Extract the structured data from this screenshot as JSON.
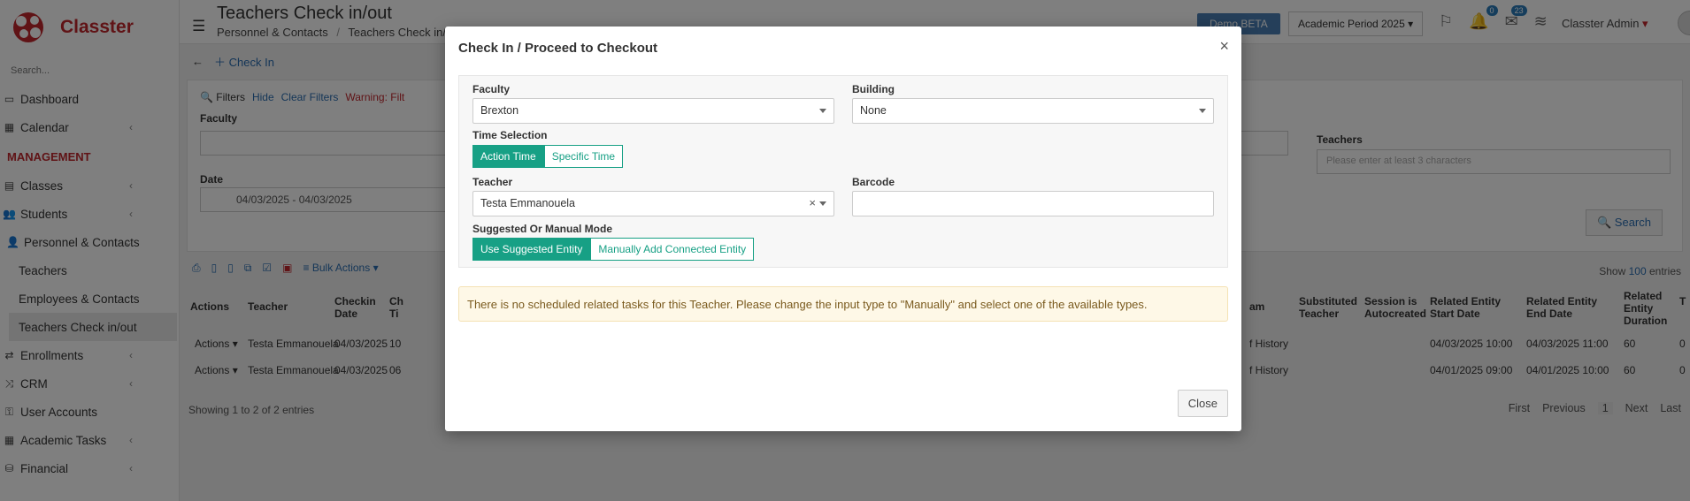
{
  "app": {
    "brand": "Classter",
    "sidebar_search_placeholder": "Search...",
    "colors": {
      "brand": "#c0272d",
      "accent": "#17a085",
      "link": "#2a6db0"
    }
  },
  "sidebar": {
    "items": [
      {
        "label": "Dashboard",
        "icon": "laptop-icon"
      },
      {
        "label": "Calendar",
        "icon": "calendar-icon"
      }
    ],
    "section": "MANAGEMENT",
    "mgmt_items": [
      {
        "label": "Classes",
        "icon": "classes-icon"
      },
      {
        "label": "Students",
        "icon": "users-icon"
      },
      {
        "label": "Personnel & Contacts",
        "icon": "user-icon"
      }
    ],
    "sub_items": [
      "Teachers",
      "Employees & Contacts",
      "Teachers Check in/out"
    ],
    "more_items": [
      {
        "label": "Enrollments",
        "icon": "exchange-icon"
      },
      {
        "label": "CRM",
        "icon": "crm-icon"
      },
      {
        "label": "User Accounts",
        "icon": "key-icon"
      },
      {
        "label": "Academic Tasks",
        "icon": "grid-icon"
      },
      {
        "label": "Financial",
        "icon": "coins-icon"
      }
    ]
  },
  "topbar": {
    "title": "Teachers Check in/out",
    "breadcrumb_1": "Personnel & Contacts",
    "breadcrumb_sep": "/",
    "breadcrumb_2": "Teachers Check in/o",
    "demo": "Demo BETA",
    "period": "Academic Period 2025",
    "notif_count": "0",
    "msg_count": "23",
    "user": "Classter Admin"
  },
  "toolbar": {
    "check_in": "Check In"
  },
  "filters": {
    "filters_label": "Filters",
    "hide": "Hide",
    "clear": "Clear Filters",
    "warning": "Warning: Filt",
    "faculty_label": "Faculty",
    "date_label": "Date",
    "date_value": "04/03/2025 - 04/03/2025",
    "teachers_label": "Teachers",
    "teachers_placeholder": "Please enter at least 3 characters",
    "search": "Search"
  },
  "list": {
    "bulk_actions": "Bulk Actions",
    "show": "Show",
    "show_count": "100",
    "entries": "entries",
    "headers": {
      "actions": "Actions",
      "teacher": "Teacher",
      "checkin_date_1": "Checkin",
      "checkin_date_2": "Date",
      "checkin_time": "Ch",
      "checkin_time_2": "Ti",
      "exam": "am",
      "substituted_1": "Substituted",
      "substituted_2": "Teacher",
      "session_1": "Session is",
      "session_2": "Autocreated",
      "rel_start_1": "Related Entity",
      "rel_start_2": "Start Date",
      "rel_end_1": "Related Entity",
      "rel_end_2": "End Date",
      "rel_dur_1": "Related",
      "rel_dur_2": "Entity",
      "rel_dur_3": "Duration",
      "last_col": "T"
    },
    "rows": [
      {
        "actions": "Actions",
        "teacher": "Testa Emmanouela",
        "date": "04/03/2025",
        "time": "10",
        "exam": "f History",
        "start": "04/03/2025 10:00",
        "end": "04/03/2025 11:00",
        "duration": "60",
        "last": "0"
      },
      {
        "actions": "Actions",
        "teacher": "Testa Emmanouela",
        "date": "04/03/2025",
        "time": "06",
        "exam": "f History",
        "start": "04/01/2025 09:00",
        "end": "04/01/2025 10:00",
        "duration": "60",
        "last": "0"
      }
    ],
    "showing": "Showing 1 to 2 of 2 entries",
    "pager": {
      "first": "First",
      "previous": "Previous",
      "current": "1",
      "next": "Next",
      "last": "Last"
    }
  },
  "modal": {
    "title": "Check In / Proceed to Checkout",
    "faculty_label": "Faculty",
    "faculty_value": "Brexton",
    "building_label": "Building",
    "building_value": "None",
    "time_selection_label": "Time Selection",
    "action_time": "Action Time",
    "specific_time": "Specific Time",
    "teacher_label": "Teacher",
    "teacher_value": "Testa Emmanouela",
    "clear_symbol": "×",
    "barcode_label": "Barcode",
    "mode_label": "Suggested Or Manual Mode",
    "use_suggested": "Use Suggested Entity",
    "manually_add": "Manually Add Connected Entity",
    "alert": "There is no scheduled related tasks for this Teacher. Please change the input type to \"Manually\" and select one of the available types.",
    "close": "Close",
    "close_x": "×"
  }
}
